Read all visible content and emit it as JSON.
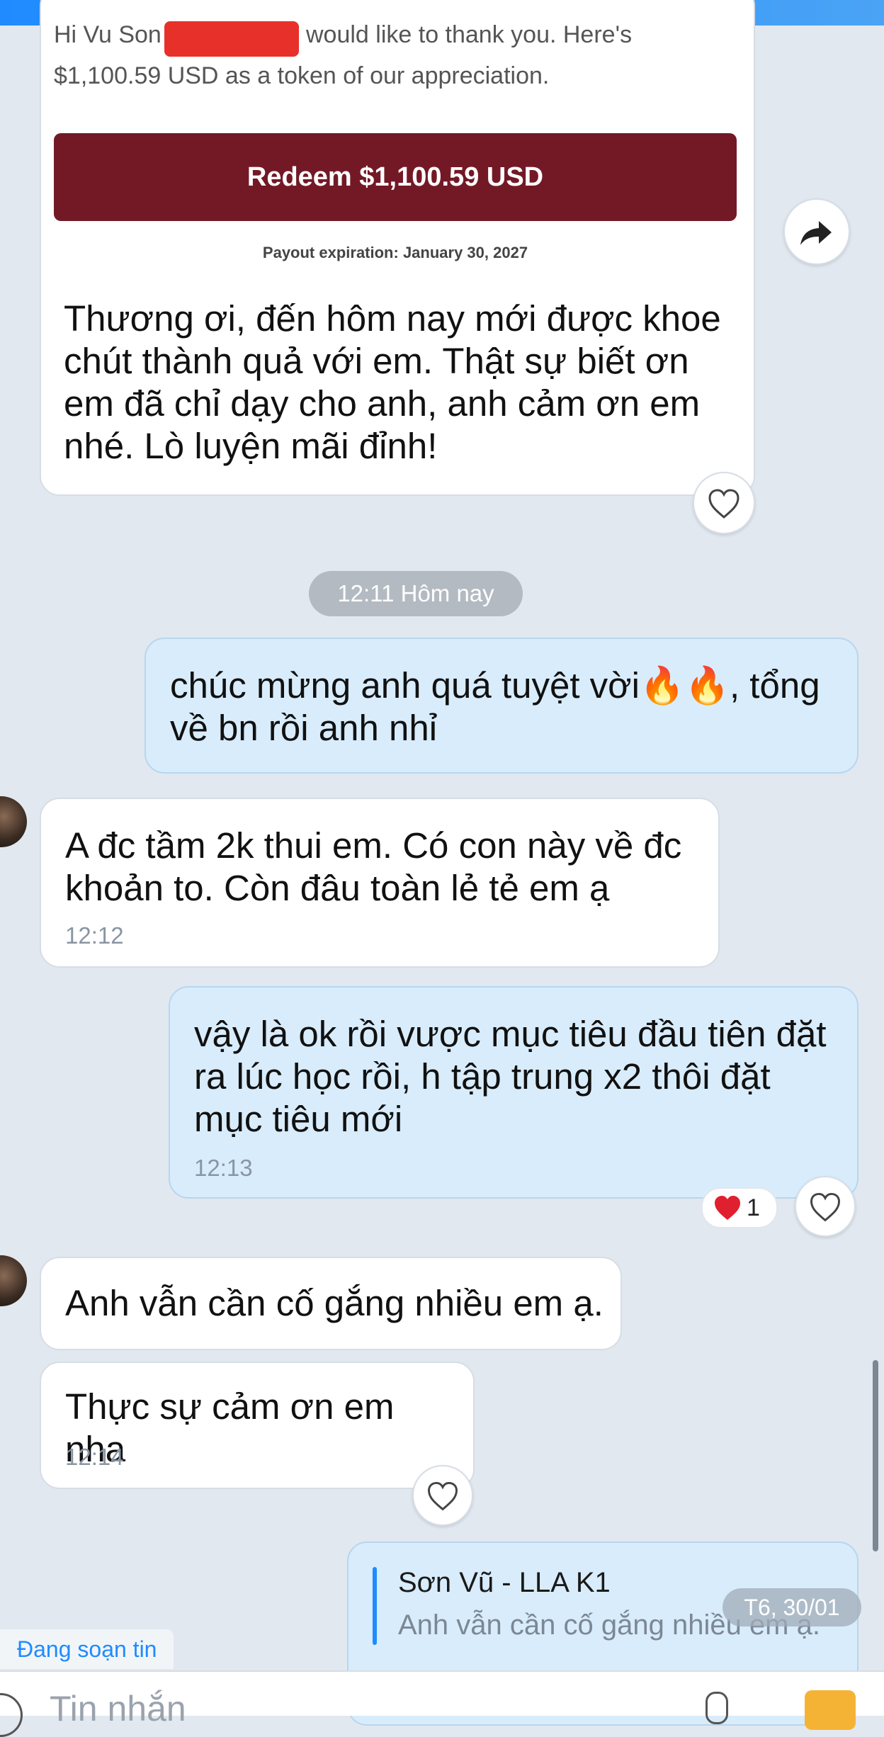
{
  "card": {
    "greeting_start": "Hi Vu Son",
    "greeting_end": "would like to thank you. Here's",
    "line2": "$1,100.59 USD as a token of our appreciation.",
    "redeem_label": "Redeem $1,100.59 USD",
    "expiration": "Payout expiration: January 30, 2027",
    "message": [
      "Thương ơi, đến hôm nay mới được khoe",
      "chút thành quả với em. Thật sự biết ơn",
      "em đã chỉ dạy cho anh, anh cảm ơn em",
      "nhé. Lò luyện mãi đỉnh!"
    ]
  },
  "divider_time": "12:11 Hôm nay",
  "messages": [
    {
      "lines": [
        "chúc mừng anh quá tuyệt vời🔥🔥, tổng",
        "về bn rồi anh nhỉ"
      ]
    },
    {
      "lines": [
        "A đc tầm 2k thui em. Có con này về đc",
        "khoản to. Còn đâu toàn lẻ tẻ em ạ"
      ],
      "time": "12:12"
    },
    {
      "lines": [
        "vậy là ok rồi vược mục tiêu đầu tiên đặt",
        "ra lúc học rồi, h tập trung x2 thôi đặt",
        "mục tiêu mới"
      ],
      "time": "12:13",
      "reaction_count": "1"
    },
    {
      "lines": [
        "Anh vẫn cần cố gắng nhiều em ạ."
      ]
    },
    {
      "lines": [
        "Thực sự cảm ơn em nha"
      ],
      "time": "12:14"
    }
  ],
  "quote": {
    "author": "Sơn Vũ - LLA K1",
    "text": "Anh vẫn cần cố gắng nhiều em ạ."
  },
  "date_badge": "T6, 30/01",
  "typing_status": "Đang soạn tin",
  "input_placeholder": "Tin nhắn",
  "colors": {
    "accent": "#1f8bff",
    "redeem": "#731926",
    "sent_bubble": "#d8ecfb",
    "received_bubble": "#ffffff"
  }
}
